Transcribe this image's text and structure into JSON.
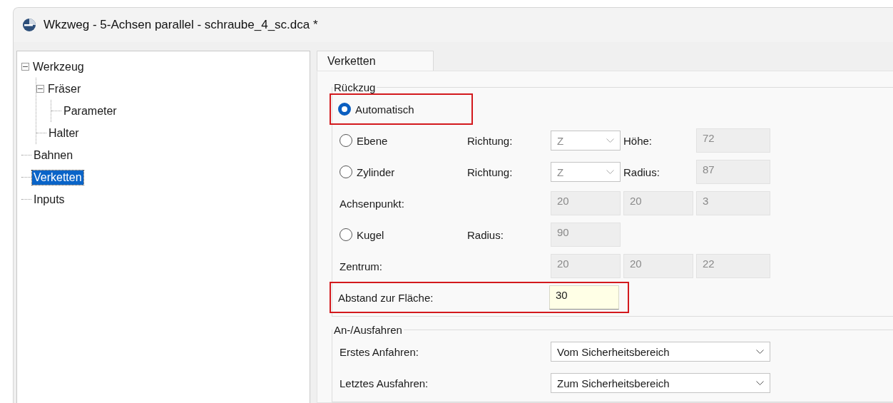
{
  "window": {
    "title": "Wkzweg - 5-Achsen parallel - schraube_4_sc.dca *"
  },
  "tree": [
    {
      "label": "Werkzeug",
      "expanded": true,
      "selected": false,
      "children": [
        {
          "label": "Fräser",
          "expanded": true,
          "selected": false,
          "children": [
            {
              "label": "Parameter",
              "selected": false
            }
          ]
        },
        {
          "label": "Halter",
          "selected": false
        }
      ]
    },
    {
      "label": "Bahnen",
      "selected": false
    },
    {
      "label": "Verketten",
      "selected": true
    },
    {
      "label": "Inputs",
      "selected": false
    }
  ],
  "tabs": [
    {
      "label": "Verketten",
      "selected": true
    }
  ],
  "groups": [
    {
      "title": "Rückzug",
      "rows": [
        {
          "kind": "radio",
          "label": "Automatisch",
          "selected": true,
          "highlighted": true,
          "controls": []
        },
        {
          "kind": "radio",
          "label": "Ebene",
          "selected": false,
          "highlighted": false,
          "sublabel": "Richtung:",
          "controls": [
            {
              "kind": "combo",
              "value": "Z",
              "disabled": true
            },
            {
              "kind": "label",
              "text": "Höhe:"
            },
            {
              "kind": "field",
              "value": "72",
              "disabled": true
            }
          ]
        },
        {
          "kind": "radio",
          "label": "Zylinder",
          "selected": false,
          "highlighted": false,
          "sublabel": "Richtung:",
          "controls": [
            {
              "kind": "combo",
              "value": "Z",
              "disabled": true
            },
            {
              "kind": "label",
              "text": "Radius:"
            },
            {
              "kind": "field",
              "value": "87",
              "disabled": true
            }
          ]
        },
        {
          "kind": "text",
          "label": "Achsenpunkt:",
          "highlighted": false,
          "controls": [
            {
              "kind": "field",
              "value": "20",
              "disabled": true
            },
            {
              "kind": "field",
              "value": "20",
              "disabled": true
            },
            {
              "kind": "field",
              "value": "3",
              "disabled": true
            }
          ]
        },
        {
          "kind": "radio",
          "label": "Kugel",
          "selected": false,
          "highlighted": false,
          "sublabel": "Radius:",
          "controls": [
            {
              "kind": "field",
              "value": "90",
              "disabled": true
            }
          ]
        },
        {
          "kind": "text",
          "label": "Zentrum:",
          "highlighted": false,
          "controls": [
            {
              "kind": "field",
              "value": "20",
              "disabled": true
            },
            {
              "kind": "field",
              "value": "20",
              "disabled": true
            },
            {
              "kind": "field",
              "value": "22",
              "disabled": true
            }
          ]
        },
        {
          "kind": "text",
          "label": "Abstand zur Fläche:",
          "highlighted": true,
          "controls": [
            {
              "kind": "field",
              "value": "30",
              "disabled": false
            }
          ]
        }
      ]
    },
    {
      "title": "An-/Ausfahren",
      "rows": [
        {
          "kind": "text",
          "label": "Erstes Anfahren:",
          "highlighted": false,
          "controls": [
            {
              "kind": "select",
              "value": "Vom Sicherheitsbereich",
              "disabled": false
            }
          ]
        },
        {
          "kind": "text",
          "label": "Letztes Ausfahren:",
          "highlighted": false,
          "controls": [
            {
              "kind": "select",
              "value": "Zum Sicherheitsbereich",
              "disabled": false
            }
          ]
        }
      ]
    }
  ]
}
